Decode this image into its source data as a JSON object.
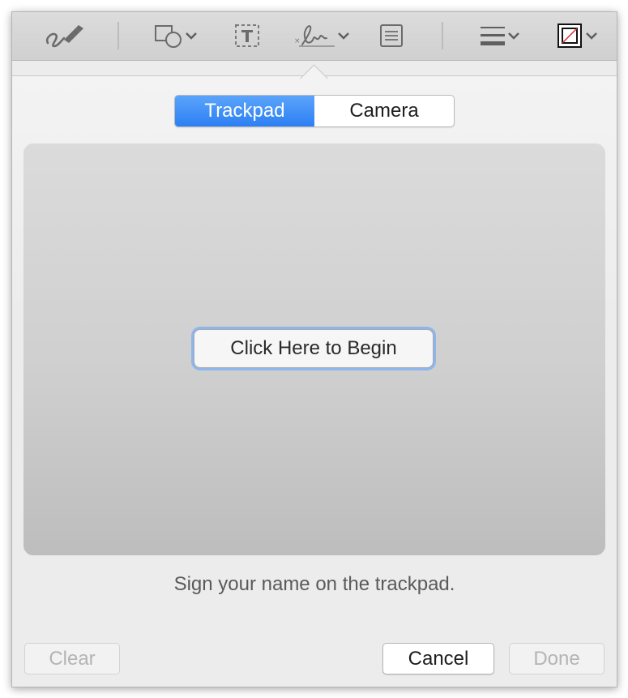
{
  "toolbar": {
    "icons": [
      "sketch-icon",
      "shapes-icon",
      "text-box-icon",
      "signature-icon",
      "note-icon",
      "line-style-icon",
      "border-color-icon"
    ]
  },
  "signature_panel": {
    "tabs": [
      {
        "label": "Trackpad",
        "active": true
      },
      {
        "label": "Camera",
        "active": false
      }
    ],
    "begin_button_label": "Click Here to Begin",
    "instruction": "Sign your name on the trackpad."
  },
  "footer": {
    "clear_label": "Clear",
    "cancel_label": "Cancel",
    "done_label": "Done"
  },
  "colors": {
    "accent": "#2d7ff3",
    "focus_ring": "#8eb6ec"
  }
}
